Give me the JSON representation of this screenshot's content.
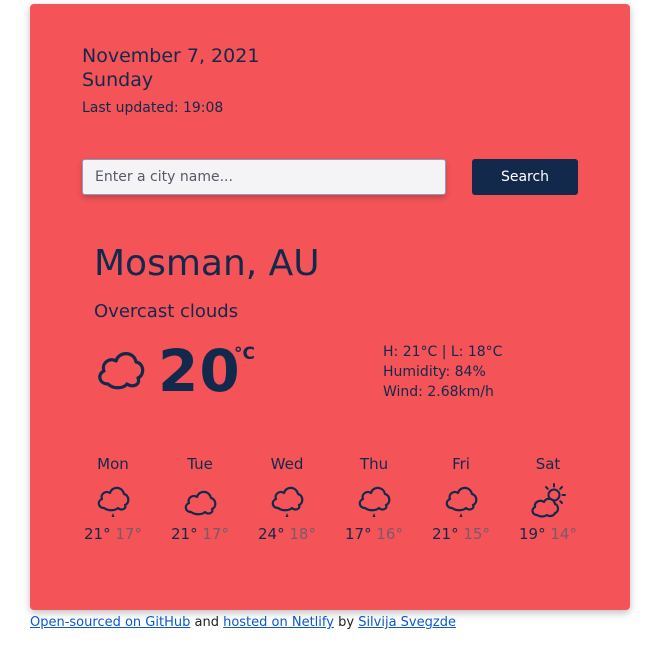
{
  "header": {
    "date": "November 7, 2021",
    "day": "Sunday",
    "last_updated": "Last updated: 19:08"
  },
  "search": {
    "placeholder": "Enter a city name...",
    "button_label": "Search"
  },
  "current": {
    "city": "Mosman, AU",
    "description": "Overcast clouds",
    "icon": "cloud-icon",
    "temperature": "20",
    "unit": "°C",
    "high_low": "H: 21°C | L: 18°C",
    "humidity": "Humidity: 84%",
    "wind": "Wind: 2.68km/h"
  },
  "forecast": [
    {
      "day": "Mon",
      "icon": "rain-cloud-icon",
      "max": "21°",
      "min": "17°"
    },
    {
      "day": "Tue",
      "icon": "cloud-icon",
      "max": "21°",
      "min": "17°"
    },
    {
      "day": "Wed",
      "icon": "rain-cloud-icon",
      "max": "24°",
      "min": "18°"
    },
    {
      "day": "Thu",
      "icon": "rain-cloud-icon",
      "max": "17°",
      "min": "16°"
    },
    {
      "day": "Fri",
      "icon": "rain-cloud-icon",
      "max": "21°",
      "min": "15°"
    },
    {
      "day": "Sat",
      "icon": "partly-sunny-icon",
      "max": "19°",
      "min": "14°"
    }
  ],
  "footer": {
    "github_link": "Open-sourced on GitHub",
    "and_text": "and",
    "netlify_link": "hosted on Netlify",
    "by_text": "by",
    "author_link": "Silvija Svegzde"
  },
  "colors": {
    "card_background": "#f45358",
    "text_primary": "#13294b",
    "button_background": "#13294b"
  }
}
